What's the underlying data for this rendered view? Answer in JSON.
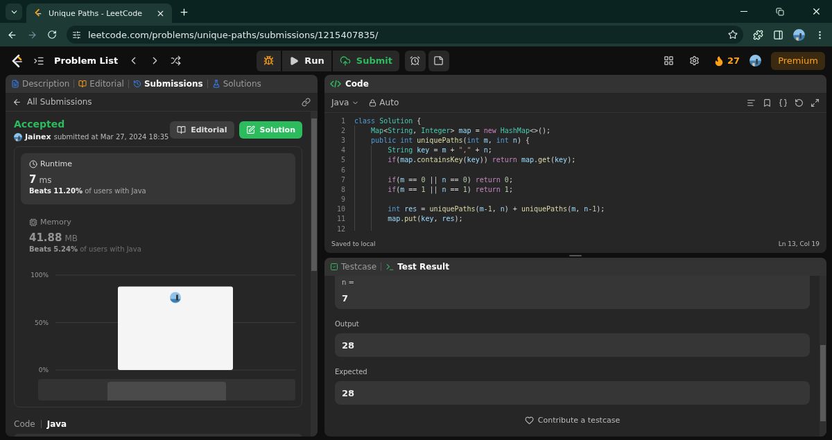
{
  "browser": {
    "tab_title": "Unique Paths - LeetCode",
    "url": "leetcode.com/problems/unique-paths/submissions/1215407835/"
  },
  "nav": {
    "title": "Problem List",
    "run": "Run",
    "submit": "Submit",
    "streak": "27",
    "premium": "Premium"
  },
  "left": {
    "tabs": [
      {
        "label": "Description",
        "selected": false,
        "kind": "description"
      },
      {
        "label": "Editorial",
        "selected": false,
        "kind": "editorial"
      },
      {
        "label": "Submissions",
        "selected": true,
        "kind": "submissions"
      },
      {
        "label": "Solutions",
        "selected": false,
        "kind": "solutions"
      }
    ],
    "back": "All Submissions",
    "status": "Accepted",
    "author": "Jainex",
    "submitted": "submitted at Mar 27, 2024 18:35",
    "editorial_button": "Editorial",
    "solution_button": "Solution",
    "metrics": [
      {
        "kind": "runtime",
        "label": "Runtime",
        "value": "7",
        "unit": "ms",
        "beats": "**Beats 11.20%** of users with Java",
        "selected": true
      },
      {
        "kind": "memory",
        "label": "Memory",
        "value": "41.88",
        "unit": "MB",
        "beats": "**Beats 5.24%** of users with Java",
        "selected": false
      }
    ],
    "chart_data": {
      "type": "bar",
      "values": [
        88
      ],
      "ylim": [
        0,
        100
      ],
      "yticks": [
        {
          "value": 0,
          "label": "0%"
        },
        {
          "value": 50,
          "label": "50%"
        },
        {
          "value": 100,
          "label": "100%"
        }
      ]
    },
    "code_tabs": [
      {
        "label": "Code",
        "selected": false
      },
      {
        "label": "Java",
        "selected": true
      }
    ]
  },
  "code": {
    "title": "Code",
    "language": "Java",
    "mode": "Auto",
    "status": "Saved to local",
    "position": "Ln 13, Col 19",
    "lines": [
      {
        "n": "1",
        "tokens": [
          {
            "text": "class ",
            "kind": "kw"
          },
          {
            "text": "Solution",
            "kind": "type"
          },
          {
            "text": " {",
            "kind": "plain"
          }
        ]
      },
      {
        "n": "2",
        "tokens": [
          {
            "text": "    Map",
            "kind": "type"
          },
          {
            "text": "<",
            "kind": "plain"
          },
          {
            "text": "String",
            "kind": "type"
          },
          {
            "text": ", ",
            "kind": "plain"
          },
          {
            "text": "Integer",
            "kind": "type"
          },
          {
            "text": "> ",
            "kind": "plain"
          },
          {
            "text": "map",
            "kind": "var"
          },
          {
            "text": " = ",
            "kind": "plain"
          },
          {
            "text": "new ",
            "kind": "ctl"
          },
          {
            "text": "HashMap",
            "kind": "type"
          },
          {
            "text": "<>();",
            "kind": "plain"
          }
        ]
      },
      {
        "n": "3",
        "tokens": [
          {
            "text": "    public int ",
            "kind": "kw"
          },
          {
            "text": "uniquePaths",
            "kind": "fn"
          },
          {
            "text": "(",
            "kind": "plain"
          },
          {
            "text": "int ",
            "kind": "kw"
          },
          {
            "text": "m",
            "kind": "var"
          },
          {
            "text": ", ",
            "kind": "plain"
          },
          {
            "text": "int ",
            "kind": "kw"
          },
          {
            "text": "n",
            "kind": "var"
          },
          {
            "text": ") {",
            "kind": "plain"
          }
        ]
      },
      {
        "n": "4",
        "tokens": [
          {
            "text": "        String ",
            "kind": "type"
          },
          {
            "text": "key",
            "kind": "var"
          },
          {
            "text": " = ",
            "kind": "plain"
          },
          {
            "text": "m",
            "kind": "var"
          },
          {
            "text": " + ",
            "kind": "plain"
          },
          {
            "text": "\",\"",
            "kind": "str"
          },
          {
            "text": " + ",
            "kind": "plain"
          },
          {
            "text": "n",
            "kind": "var"
          },
          {
            "text": ";",
            "kind": "plain"
          }
        ]
      },
      {
        "n": "5",
        "tokens": [
          {
            "text": "        if",
            "kind": "ctl"
          },
          {
            "text": "(",
            "kind": "plain"
          },
          {
            "text": "map",
            "kind": "var"
          },
          {
            "text": ".",
            "kind": "plain"
          },
          {
            "text": "containsKey",
            "kind": "fn"
          },
          {
            "text": "(",
            "kind": "plain"
          },
          {
            "text": "key",
            "kind": "var"
          },
          {
            "text": ")) ",
            "kind": "plain"
          },
          {
            "text": "return ",
            "kind": "ctl"
          },
          {
            "text": "map",
            "kind": "var"
          },
          {
            "text": ".",
            "kind": "plain"
          },
          {
            "text": "get",
            "kind": "fn"
          },
          {
            "text": "(",
            "kind": "plain"
          },
          {
            "text": "key",
            "kind": "var"
          },
          {
            "text": ");",
            "kind": "plain"
          }
        ]
      },
      {
        "n": "6"
      },
      {
        "n": "7",
        "tokens": [
          {
            "text": "        if",
            "kind": "ctl"
          },
          {
            "text": "(",
            "kind": "plain"
          },
          {
            "text": "m",
            "kind": "var"
          },
          {
            "text": " == ",
            "kind": "plain"
          },
          {
            "text": "0",
            "kind": "num"
          },
          {
            "text": " || ",
            "kind": "plain"
          },
          {
            "text": "n",
            "kind": "var"
          },
          {
            "text": " == ",
            "kind": "plain"
          },
          {
            "text": "0",
            "kind": "num"
          },
          {
            "text": ") ",
            "kind": "plain"
          },
          {
            "text": "return ",
            "kind": "ctl"
          },
          {
            "text": "0",
            "kind": "num"
          },
          {
            "text": ";",
            "kind": "plain"
          }
        ]
      },
      {
        "n": "8",
        "tokens": [
          {
            "text": "        if",
            "kind": "ctl"
          },
          {
            "text": "(",
            "kind": "plain"
          },
          {
            "text": "m",
            "kind": "var"
          },
          {
            "text": " == ",
            "kind": "plain"
          },
          {
            "text": "1",
            "kind": "num"
          },
          {
            "text": " || ",
            "kind": "plain"
          },
          {
            "text": "n",
            "kind": "var"
          },
          {
            "text": " == ",
            "kind": "plain"
          },
          {
            "text": "1",
            "kind": "num"
          },
          {
            "text": ") ",
            "kind": "plain"
          },
          {
            "text": "return ",
            "kind": "ctl"
          },
          {
            "text": "1",
            "kind": "num"
          },
          {
            "text": ";",
            "kind": "plain"
          }
        ]
      },
      {
        "n": "9"
      },
      {
        "n": "10",
        "tokens": [
          {
            "text": "        int ",
            "kind": "kw"
          },
          {
            "text": "res",
            "kind": "var"
          },
          {
            "text": " = ",
            "kind": "plain"
          },
          {
            "text": "uniquePaths",
            "kind": "fn"
          },
          {
            "text": "(",
            "kind": "plain"
          },
          {
            "text": "m",
            "kind": "var"
          },
          {
            "text": "-",
            "kind": "plain"
          },
          {
            "text": "1",
            "kind": "num"
          },
          {
            "text": ", ",
            "kind": "plain"
          },
          {
            "text": "n",
            "kind": "var"
          },
          {
            "text": ") + ",
            "kind": "plain"
          },
          {
            "text": "uniquePaths",
            "kind": "fn"
          },
          {
            "text": "(",
            "kind": "plain"
          },
          {
            "text": "m",
            "kind": "var"
          },
          {
            "text": ", ",
            "kind": "plain"
          },
          {
            "text": "n",
            "kind": "var"
          },
          {
            "text": "-",
            "kind": "plain"
          },
          {
            "text": "1",
            "kind": "num"
          },
          {
            "text": ");",
            "kind": "plain"
          }
        ]
      },
      {
        "n": "11",
        "tokens": [
          {
            "text": "        map",
            "kind": "var"
          },
          {
            "text": ".",
            "kind": "plain"
          },
          {
            "text": "put",
            "kind": "fn"
          },
          {
            "text": "(",
            "kind": "plain"
          },
          {
            "text": "key",
            "kind": "var"
          },
          {
            "text": ", ",
            "kind": "plain"
          },
          {
            "text": "res",
            "kind": "var"
          },
          {
            "text": ");",
            "kind": "plain"
          }
        ]
      },
      {
        "n": "12"
      }
    ]
  },
  "result": {
    "tabs": [
      {
        "label": "Testcase",
        "selected": false,
        "kind": "testcase"
      },
      {
        "label": "Test Result",
        "selected": true,
        "kind": "result"
      }
    ],
    "input_label": "n =",
    "input_value": "7",
    "sections": [
      {
        "label": "Output",
        "value": "28"
      },
      {
        "label": "Expected",
        "value": "28"
      }
    ],
    "contribute": "Contribute a testcase"
  }
}
